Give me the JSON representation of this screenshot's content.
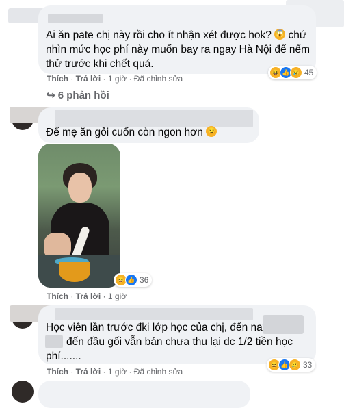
{
  "comment1": {
    "text": "Ai ăn pate chị này rồi cho ít nhận xét được hok?",
    "text2": "chứ nhìn mức học phí này muốn bay ra ngay Hà Nội để nếm thử trước khi chết quá.",
    "emoji": "scream-emoji",
    "reaction_count": "45",
    "like": "Thích",
    "reply": "Trả lời",
    "time": "1 giờ",
    "edited": "Đã chỉnh sửa",
    "replies": "6 phản hồi"
  },
  "comment2": {
    "text": "Để mẹ ăn gỏi cuốn còn ngon hơn",
    "emoji": "smirk-emoji",
    "reaction_count": "36",
    "like": "Thích",
    "reply": "Trả lời",
    "time": "1 giờ"
  },
  "comment3": {
    "text_a": "Học viên lần trước đki lớp học của chị, đến nay",
    "text_b": "đến đầu gối vẫn bán chưa thu lại dc 1/2 tiền học",
    "text_c": "phí.......",
    "reaction_count": "33",
    "like": "Thích",
    "reply": "Trả lời",
    "time": "1 giờ",
    "edited": "Đã chỉnh sửa"
  },
  "colors": {
    "bubble": "#f0f2f5",
    "meta_text": "#65676b",
    "like_blue": "#1877f2",
    "haha_yellow": "#f7b125"
  }
}
